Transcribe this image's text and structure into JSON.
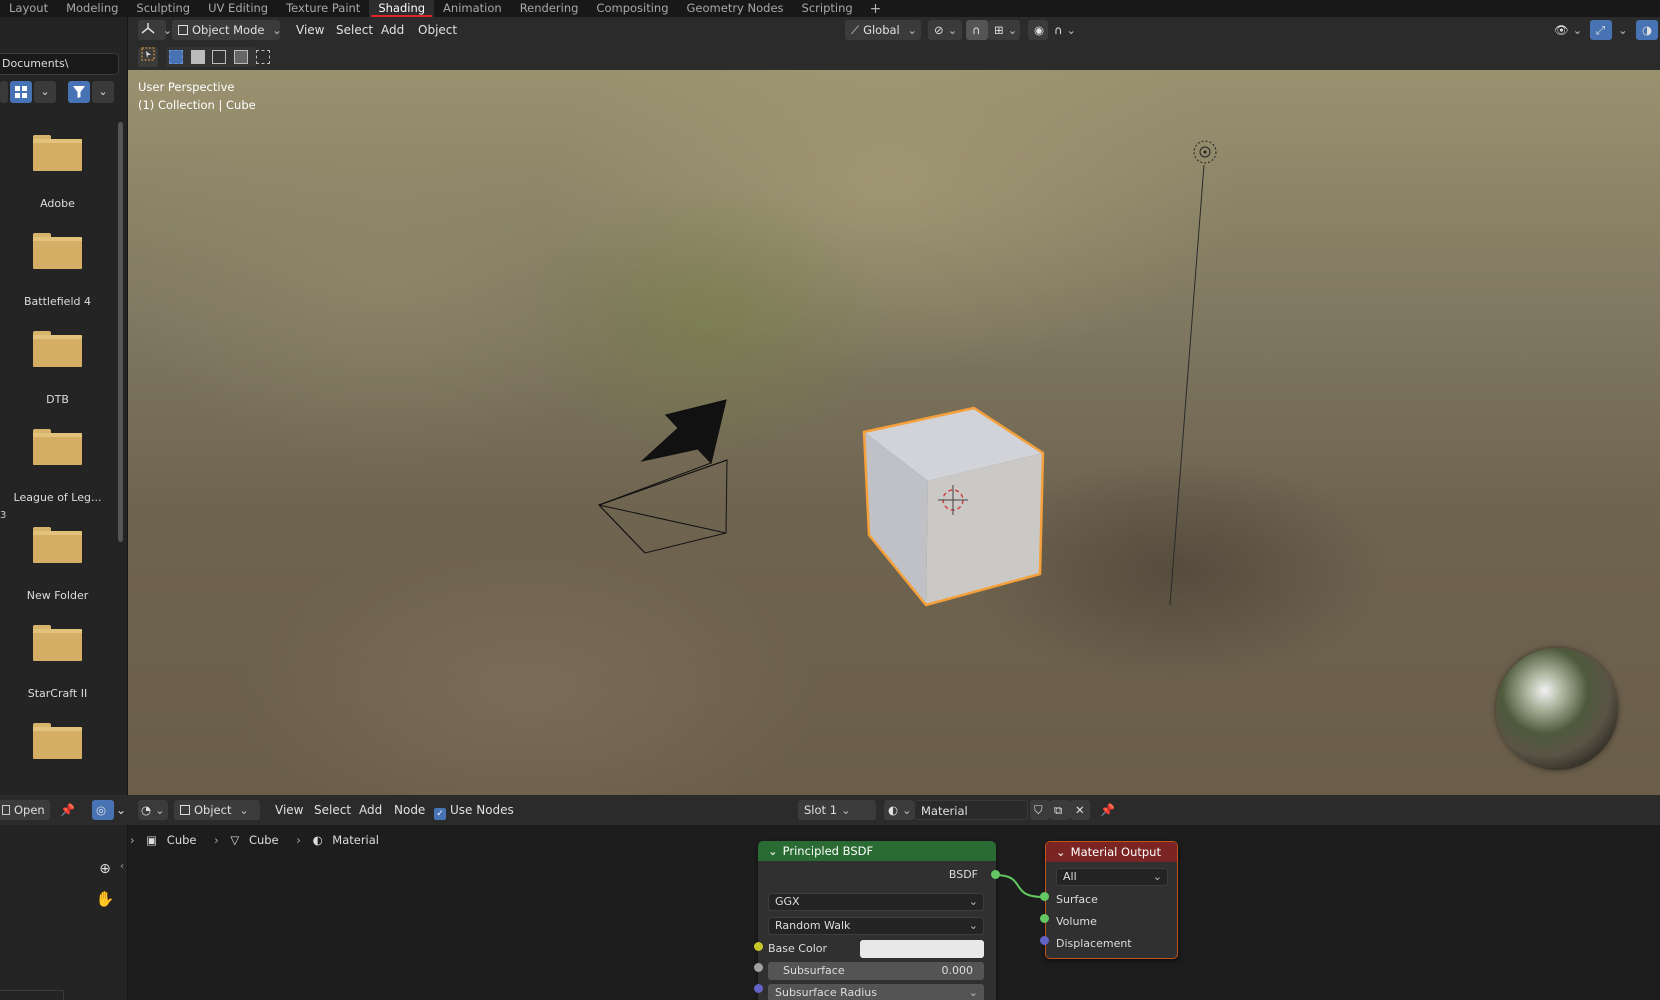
{
  "workspace_tabs": [
    "Layout",
    "Modeling",
    "Sculpting",
    "UV Editing",
    "Texture Paint",
    "Shading",
    "Animation",
    "Rendering",
    "Compositing",
    "Geometry Nodes",
    "Scripting"
  ],
  "active_tab": "Shading",
  "file_browser": {
    "path": "Documents\\",
    "folders": [
      "Adobe",
      "Battlefield 4",
      "DTB",
      "League of Leg...",
      "New Folder",
      "StarCraft II",
      ""
    ],
    "side_mark": "3"
  },
  "viewport_header": {
    "mode": "Object Mode",
    "menus": [
      "View",
      "Select",
      "Add",
      "Object"
    ],
    "transform_orientation": "Global"
  },
  "viewport": {
    "perspective_label": "User Perspective",
    "collection_label": "(1) Collection | Cube",
    "colors": {
      "selection_outline": "#f5a03a",
      "cube_face": "#c8c8cc",
      "camera_line": "#111111"
    }
  },
  "node_editor_header": {
    "open_label": "Open",
    "editor_type": "Object",
    "menus": [
      "View",
      "Select",
      "Add",
      "Node"
    ],
    "use_nodes_label": "Use Nodes",
    "slot": "Slot 1",
    "material_name": "Material"
  },
  "breadcrumb": {
    "object": "Cube",
    "mesh": "Cube",
    "material": "Material"
  },
  "principled_node": {
    "title": "Principled BSDF",
    "output_label": "BSDF",
    "distribution": "GGX",
    "subsurface_method": "Random Walk",
    "base_color_label": "Base Color",
    "subsurface_label": "Subsurface",
    "subsurface_value": "0.000",
    "subsurface_radius_label": "Subsurface Radius",
    "header_color": "#2a6b33"
  },
  "output_node": {
    "title": "Material Output",
    "target": "All",
    "inputs": [
      "Surface",
      "Volume",
      "Displacement"
    ],
    "header_color": "#7a2424"
  }
}
